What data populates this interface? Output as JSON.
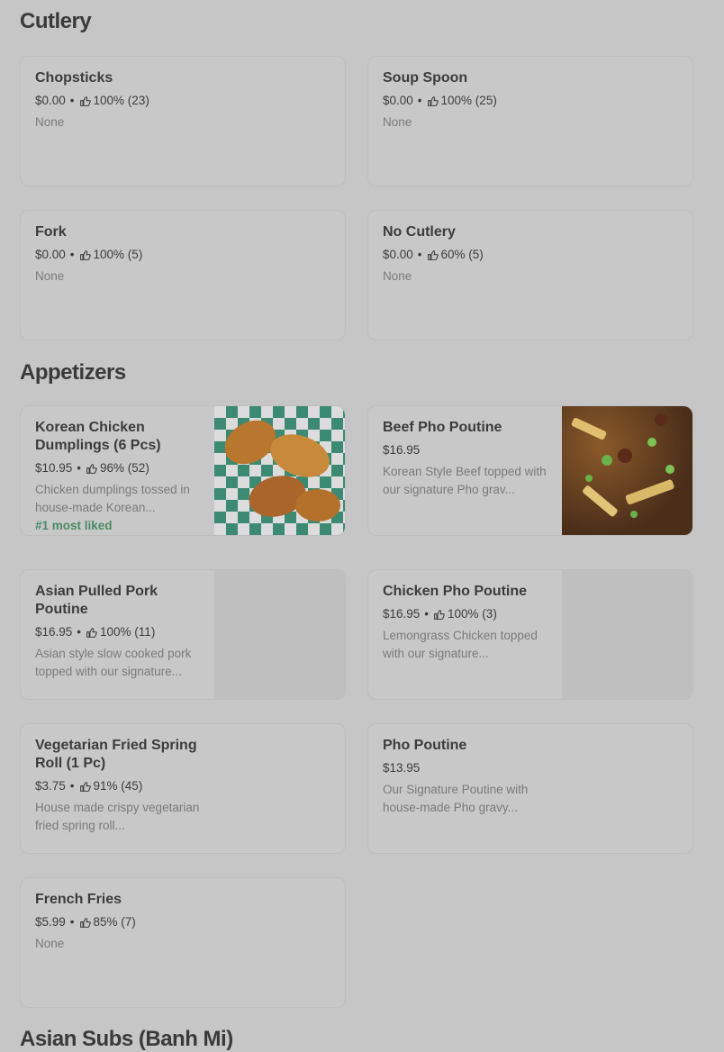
{
  "sections": [
    {
      "title": "Cutlery",
      "items": [
        {
          "name": "Chopsticks",
          "price": "$0.00",
          "rating": "100% (23)",
          "desc": "None"
        },
        {
          "name": "Soup Spoon",
          "price": "$0.00",
          "rating": "100% (25)",
          "desc": "None"
        },
        {
          "name": "Fork",
          "price": "$0.00",
          "rating": "100% (5)",
          "desc": "None"
        },
        {
          "name": "No Cutlery",
          "price": "$0.00",
          "rating": "60% (5)",
          "desc": "None"
        }
      ]
    },
    {
      "title": "Appetizers",
      "items": [
        {
          "name": "Korean Chicken Dumplings (6 Pcs)",
          "price": "$10.95",
          "rating": "96% (52)",
          "desc": "Chicken dumplings tossed in house-made Korean...",
          "badge": "#1 most liked"
        },
        {
          "name": "Beef Pho Poutine",
          "price": "$16.95",
          "desc": "Korean Style Beef topped with our signature Pho grav..."
        },
        {
          "name": "Asian Pulled Pork Poutine",
          "price": "$16.95",
          "rating": "100% (11)",
          "desc": "Asian style slow cooked pork topped with our signature..."
        },
        {
          "name": "Chicken Pho Poutine",
          "price": "$16.95",
          "rating": "100% (3)",
          "desc": "Lemongrass Chicken topped with our signature..."
        },
        {
          "name": "Vegetarian Fried Spring Roll (1 Pc)",
          "price": "$3.75",
          "rating": "91% (45)",
          "desc": "House made crispy vegetarian fried spring roll..."
        },
        {
          "name": "Pho Poutine",
          "price": "$13.95",
          "desc": "Our Signature Poutine with house-made Pho gravy..."
        },
        {
          "name": "French Fries",
          "price": "$5.99",
          "rating": "85% (7)",
          "desc": "None"
        }
      ]
    },
    {
      "title": "Asian Subs (Banh Mi)",
      "items": []
    }
  ],
  "separator": "•",
  "icons": {
    "rating": "thumbs-up-icon",
    "food_photo": "food-photo-icon"
  },
  "colors": {
    "badge": "#4a8a66",
    "background": "#c6c6c6"
  }
}
